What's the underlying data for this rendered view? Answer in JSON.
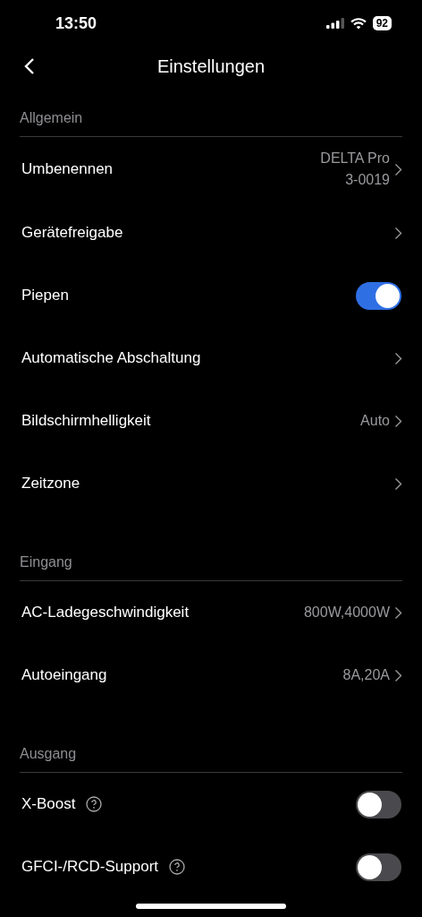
{
  "status_bar": {
    "time": "13:50",
    "battery": "92"
  },
  "nav": {
    "title": "Einstellungen"
  },
  "sections": [
    {
      "title": "Allgemein",
      "rows": [
        {
          "kind": "link",
          "label": "Umbenennen",
          "value": "DELTA Pro\n3-0019",
          "help": false
        },
        {
          "kind": "link",
          "label": "Gerätefreigabe",
          "help": false
        },
        {
          "kind": "toggle",
          "label": "Piepen",
          "on": true,
          "help": false
        },
        {
          "kind": "link",
          "label": "Automatische Abschaltung",
          "help": false
        },
        {
          "kind": "link",
          "label": "Bildschirmhelligkeit",
          "value": "Auto",
          "help": false
        },
        {
          "kind": "link",
          "label": "Zeitzone",
          "help": false
        }
      ]
    },
    {
      "title": "Eingang",
      "rows": [
        {
          "kind": "link",
          "label": "AC-Ladegeschwindigkeit",
          "value": "800W,4000W",
          "help": false
        },
        {
          "kind": "link",
          "label": "Autoeingang",
          "value": "8A,20A",
          "help": false
        }
      ]
    },
    {
      "title": "Ausgang",
      "rows": [
        {
          "kind": "toggle",
          "label": "X-Boost",
          "on": false,
          "help": true
        },
        {
          "kind": "toggle",
          "label": "GFCI-/RCD-Support",
          "on": false,
          "help": true
        }
      ]
    }
  ]
}
